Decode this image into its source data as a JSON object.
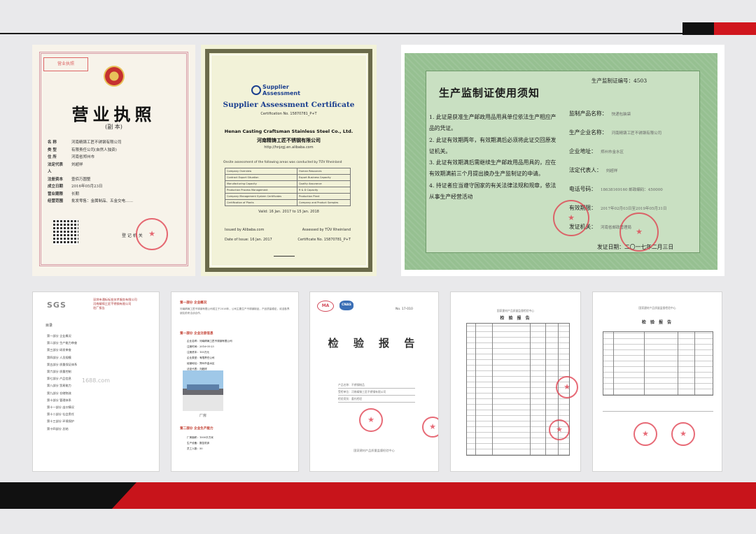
{
  "colors": {
    "accent_red": "#d0161d",
    "band_black": "#111111",
    "cert_green": "#96c091",
    "stamp_red": "#e03a4a"
  },
  "business_license": {
    "title": "营业执照",
    "copy_label": "(副 本)",
    "issuer": "登 记 机 关",
    "rows": [
      {
        "k": "名 称",
        "v": "河南精铸工匠不锈钢有限公司"
      },
      {
        "k": "类 型",
        "v": "有限责任公司(自然人独资)"
      },
      {
        "k": "住 所",
        "v": "河南省郑州市"
      },
      {
        "k": "法定代表人",
        "v": "刘超祥"
      },
      {
        "k": "注册资本",
        "v": "壹佰万圆整"
      },
      {
        "k": "成立日期",
        "v": "2016年05月23日"
      },
      {
        "k": "营业期限",
        "v": "长期"
      },
      {
        "k": "经营范围",
        "v": "批发零售：金属制品、五金交电……"
      }
    ]
  },
  "supplier_cert": {
    "logo_line1": "Supplier",
    "logo_line2": "Assessment",
    "title": "Supplier Assessment Certificate",
    "cert_no": "Certification No. 15870781_P+T",
    "company_en": "Henan Casting Craftsman Stainless Steel Co., Ltd.",
    "company_cn": "河南精铸工匠不锈钢有限公司",
    "url": "http://hnjzgj.en.alibaba.com",
    "intro": "Onsite assessment of the following areas was conducted by TÜV Rheinland",
    "table": [
      [
        "Company Overview",
        "Human Resources"
      ],
      [
        "Contract Export Situation",
        "Export Business Capacity"
      ],
      [
        "Manufacturing Capacity",
        "Quality Assurance"
      ],
      [
        "Production Process Management",
        "R & D Capacity"
      ],
      [
        "Company Management System Certificates",
        "Production Plant"
      ],
      [
        "Certification of Plants",
        "Company and Product Samples"
      ]
    ],
    "valid": "Valid: 16 Jan. 2017 to 15 Jan. 2018",
    "issued_by": "Issued by Alibaba.com",
    "assessed_by": "Assessed by TÜV Rheinland",
    "date_issue": "Date of Issue: 16 Jan. 2017",
    "cert_no_short": "Certificate No. 15870781_P+T"
  },
  "production_license": {
    "title": "生产监制证使用须知",
    "cert_no_label": "生产监制证编号：",
    "cert_no": "4503",
    "rules": [
      "1. 此证是获准生产邮政用品用具单位依法生产相应产品的凭证。",
      "2. 此证有效期两年，有效期满后必须将此证交回原发证机关。",
      "3. 此证有效期满后需继续生产邮政用品用具的，应在有效期满前三个月提出换办生产监制证的申请。",
      "4. 持证者应当遵守国家的有关法律法规和规章，依法从事生产经营活动"
    ],
    "fields": [
      {
        "k": "监制产品名称：",
        "v": "快递包装袋"
      },
      {
        "k": "生产企业名称：",
        "v": "河南精铸工匠不锈钢有限公司"
      },
      {
        "k": "企业地址：",
        "v": "郑州市金水区"
      },
      {
        "k": "法定代表人：",
        "v": "刘超祥"
      },
      {
        "k": "电话号码：",
        "v": "18638169160  邮政编码：450000"
      },
      {
        "k": "有效期限：",
        "v": "2017年02月03日至2019年05月31日"
      },
      {
        "k": "发证机关：",
        "v": "河南省邮政管理局"
      }
    ],
    "issue_label": "发证日期：二〇一七年二月三日"
  },
  "sgs_report": {
    "logo": "SGS",
    "head": "深圳市通标标准技术服务有限公司\n河南精铸工匠不锈钢有限公司\n验厂报告",
    "toc_title": "目录",
    "toc": [
      "第一部分 企业概况",
      "第二部分 生产能力审查",
      "第三部分 研发审查",
      "第四部分 人员规模",
      "第五部分 质量保证体系",
      "第六部分 质量控制",
      "第七部分 产品信息",
      "第八部分 贸易能力",
      "第九部分 仓储物流",
      "第十部分 管理体系",
      "第十一部分 出口情况",
      "第十二部分 社会责任",
      "第十三部分 环境保护",
      "第十四部分 总结"
    ],
    "watermark": "1688.com"
  },
  "company_profile": {
    "sec1": "第一部分 企业概况",
    "intro": "河南精铸工匠不锈钢有限公司成立于2016年，公司主要生产不锈钢制品，产品质量稳定，欢迎各界朋友前来洽谈合作。",
    "sec2": "第一部分 企业注册信息",
    "kv": [
      "企业名称：河南精铸工匠不锈钢有限公司",
      "注册时间：2016-05-23",
      "注册资本：100万元",
      "企业类型：有限责任公司",
      "经营地址：郑州市金水区",
      "法定代表：刘超祥"
    ],
    "sec3": "第二部分 企业生产能力",
    "kv2": [
      "厂房面积：1000平方米",
      "生产设备：数控机床",
      "员工人数：50"
    ],
    "photo_caption": "厂房"
  },
  "test_report": {
    "ma": "MA",
    "cnas": "CNAS",
    "no": "No. 17-010",
    "title": "检 验 报 告",
    "lines": [
      "产品名称：不锈钢制品",
      "受检单位：河南精铸工匠不锈钢有限公司",
      "检验类别：委托检验"
    ],
    "footer": "国家建材产品质量监督检验中心"
  },
  "table_report_1": {
    "head": "国家建材产品质量监督检验中心",
    "title": "检 验 报 告"
  },
  "table_report_2": {
    "head": "国家建材产品质量监督检验中心",
    "title": "检 验 报 告"
  }
}
